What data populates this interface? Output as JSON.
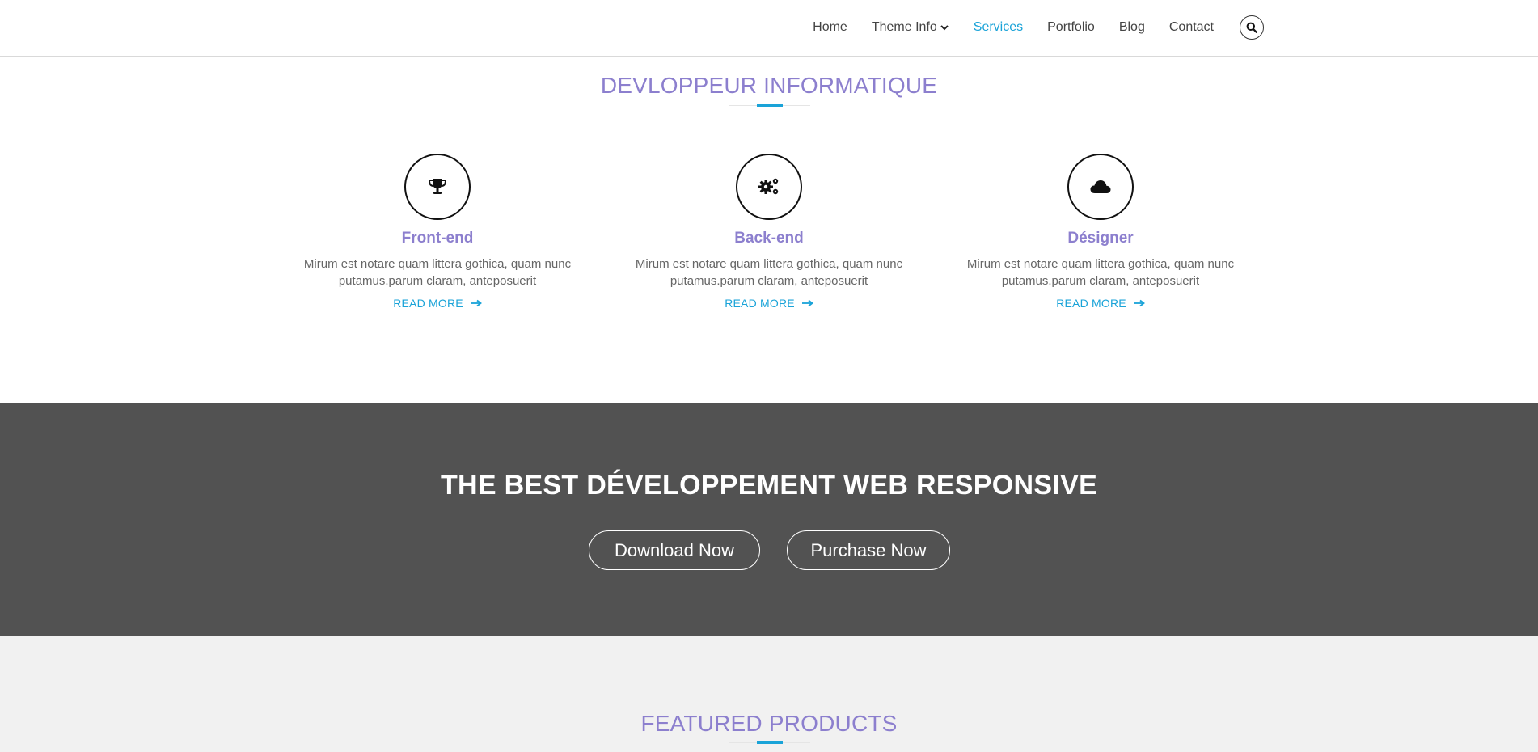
{
  "nav": {
    "items": [
      {
        "label": "Home",
        "active": false
      },
      {
        "label": "Theme Info",
        "active": false,
        "dropdown": true
      },
      {
        "label": "Services",
        "active": true
      },
      {
        "label": "Portfolio",
        "active": false
      },
      {
        "label": "Blog",
        "active": false
      },
      {
        "label": "Contact",
        "active": false
      }
    ],
    "search_icon": "search-icon"
  },
  "services_section": {
    "title": "DEVLOPPEUR INFORMATIQUE",
    "items": [
      {
        "icon": "trophy-icon",
        "title": "Front-end",
        "text": "Mirum est notare quam littera gothica, quam nunc putamus.parum claram, anteposuerit",
        "link": "READ MORE"
      },
      {
        "icon": "gears-icon",
        "title": "Back-end",
        "text": "Mirum est notare quam littera gothica, quam nunc putamus.parum claram, anteposuerit",
        "link": "READ MORE"
      },
      {
        "icon": "cloud-icon",
        "title": "Désigner",
        "text": "Mirum est notare quam littera gothica, quam nunc putamus.parum claram, anteposuerit",
        "link": "READ MORE"
      }
    ]
  },
  "banner": {
    "title": "THE BEST DÉVELOPPEMENT WEB RESPONSIVE",
    "download_label": "Download Now",
    "purchase_label": "Purchase Now"
  },
  "featured": {
    "title": "FEATURED PRODUCTS"
  },
  "colors": {
    "accent": "#1aa3d8",
    "heading": "#8c7fce",
    "banner_bg": "#525252",
    "featured_bg": "#f1f1f1"
  }
}
